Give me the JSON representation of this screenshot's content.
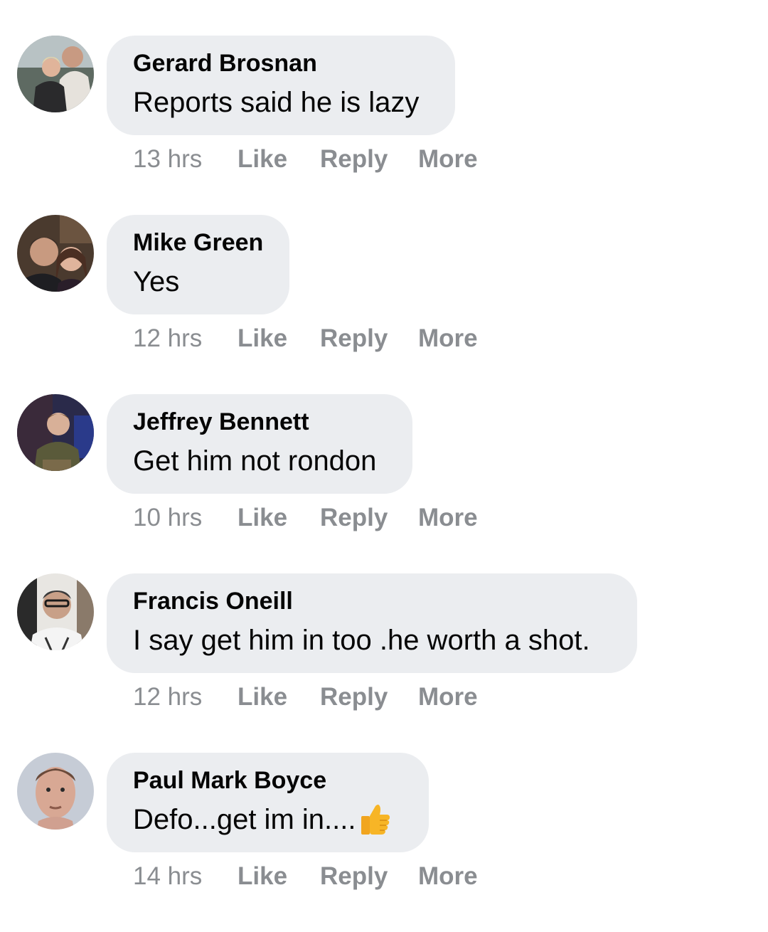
{
  "comments": [
    {
      "author": "Gerard Brosnan",
      "text": "Reports said he is lazy",
      "time": "13 hrs",
      "like_label": "Like",
      "reply_label": "Reply",
      "more_label": "More"
    },
    {
      "author": "Mike Green",
      "text": "Yes",
      "time": "12 hrs",
      "like_label": "Like",
      "reply_label": "Reply",
      "more_label": "More"
    },
    {
      "author": "Jeffrey Bennett",
      "text": "Get him not rondon",
      "time": "10 hrs",
      "like_label": "Like",
      "reply_label": "Reply",
      "more_label": "More"
    },
    {
      "author": "Francis Oneill",
      "text": "I say get him in too .he worth a shot.",
      "time": "12 hrs",
      "like_label": "Like",
      "reply_label": "Reply",
      "more_label": "More"
    },
    {
      "author": "Paul Mark Boyce",
      "text": "Defo...get im in....",
      "emoji": "thumbs-up-emoji",
      "time": "14 hrs",
      "like_label": "Like",
      "reply_label": "Reply",
      "more_label": "More"
    }
  ],
  "colors": {
    "bubble": "#ebedf0",
    "meta": "#8a8d91",
    "text": "#050505"
  }
}
